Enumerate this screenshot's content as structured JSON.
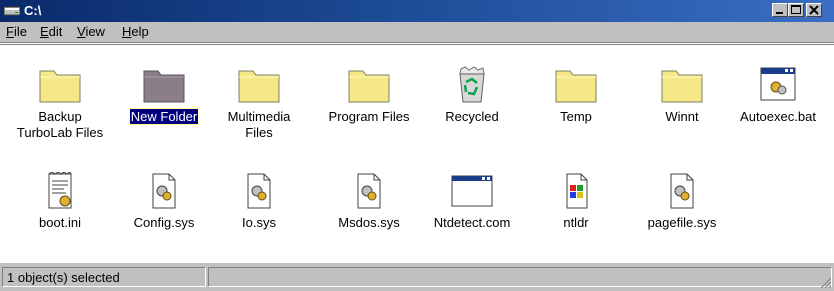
{
  "window": {
    "title": "C:\\"
  },
  "menu": [
    {
      "label": "File",
      "key": "F",
      "rest": "ile"
    },
    {
      "label": "Edit",
      "key": "E",
      "rest": "dit"
    },
    {
      "label": "View",
      "key": "V",
      "rest": "iew"
    },
    {
      "label": "Help",
      "key": "H",
      "rest": "elp"
    }
  ],
  "items": [
    {
      "name": "Backup TurboLab Files",
      "line1": "Backup",
      "line2": "TurboLab Files",
      "icon": "folder-icon",
      "selected": false
    },
    {
      "name": "New Folder",
      "line1": "New Folder",
      "line2": "",
      "icon": "folder-icon",
      "selected": true
    },
    {
      "name": "Multimedia Files",
      "line1": "Multimedia",
      "line2": "Files",
      "icon": "folder-icon",
      "selected": false
    },
    {
      "name": "Program Files",
      "line1": "Program Files",
      "line2": "",
      "icon": "folder-icon",
      "selected": false
    },
    {
      "name": "Recycled",
      "line1": "Recycled",
      "line2": "",
      "icon": "recycle-bin-icon",
      "selected": false
    },
    {
      "name": "Temp",
      "line1": "Temp",
      "line2": "",
      "icon": "folder-icon",
      "selected": false
    },
    {
      "name": "Winnt",
      "line1": "Winnt",
      "line2": "",
      "icon": "folder-icon",
      "selected": false
    },
    {
      "name": "Autoexec.bat",
      "line1": "Autoexec.bat",
      "line2": "",
      "icon": "batch-file-icon",
      "selected": false
    },
    {
      "name": "boot.ini",
      "line1": "boot.ini",
      "line2": "",
      "icon": "ini-file-icon",
      "selected": false
    },
    {
      "name": "Config.sys",
      "line1": "Config.sys",
      "line2": "",
      "icon": "system-file-icon",
      "selected": false
    },
    {
      "name": "Io.sys",
      "line1": "Io.sys",
      "line2": "",
      "icon": "system-file-icon",
      "selected": false
    },
    {
      "name": "Msdos.sys",
      "line1": "Msdos.sys",
      "line2": "",
      "icon": "system-file-icon",
      "selected": false
    },
    {
      "name": "Ntdetect.com",
      "line1": "Ntdetect.com",
      "line2": "",
      "icon": "application-window-icon",
      "selected": false
    },
    {
      "name": "ntldr",
      "line1": "ntldr",
      "line2": "",
      "icon": "loader-file-icon",
      "selected": false
    },
    {
      "name": "pagefile.sys",
      "line1": "pagefile.sys",
      "line2": "",
      "icon": "system-file-icon",
      "selected": false
    }
  ],
  "status": {
    "text": "1 object(s) selected"
  },
  "colors": {
    "folder": "#f5e987",
    "folder_selected": "#8a7f88",
    "titlebar": "#0a2a6a",
    "selection": "#000080"
  }
}
